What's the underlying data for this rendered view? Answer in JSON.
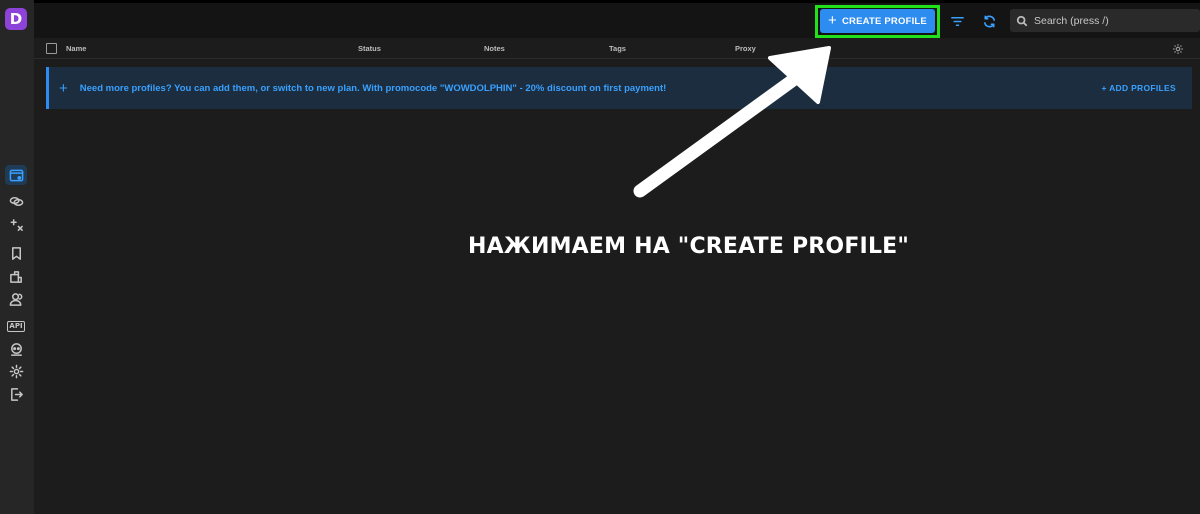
{
  "app": {
    "logo_letter": "D",
    "brand_color": "#8e43d8",
    "accent_color": "#2d8cf0",
    "highlight_color": "#22e01b"
  },
  "sidebar": {
    "items": [
      {
        "icon": "browser-profiles-icon",
        "active": true
      },
      {
        "icon": "chain-link-icon"
      },
      {
        "icon": "automation-sparkle-icon"
      },
      {
        "icon": "bookmark-icon"
      },
      {
        "icon": "extensions-icon"
      },
      {
        "icon": "users-icon"
      },
      {
        "icon": "api-icon",
        "label": "API"
      },
      {
        "icon": "support-bot-icon"
      },
      {
        "icon": "gear-icon"
      },
      {
        "icon": "logout-icon"
      }
    ]
  },
  "toolbar": {
    "create_label": "CREATE PROFILE",
    "filter_icon": "filter-icon",
    "refresh_icon": "refresh-icon",
    "search_placeholder": "Search (press /)"
  },
  "table": {
    "columns": [
      "Name",
      "Status",
      "Notes",
      "Tags",
      "Proxy"
    ]
  },
  "banner": {
    "text": "Need more profiles? You can add them, or switch to new plan. With promocode \"WOWDOLPHIN\" - 20% discount on first payment!",
    "action": "+ ADD PROFILES"
  },
  "annotation": {
    "text": "НАЖИМАЕМ НА \"CREATE PROFILE\""
  }
}
